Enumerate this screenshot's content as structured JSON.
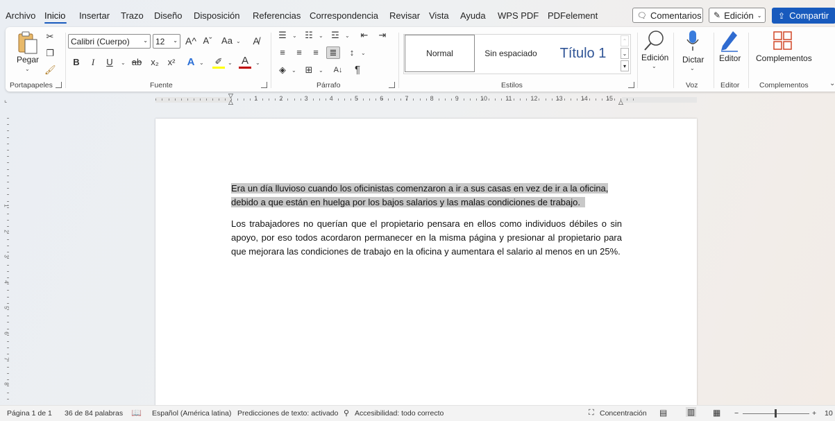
{
  "menu": {
    "items": [
      "Archivo",
      "Inicio",
      "Insertar",
      "Trazo",
      "Diseño",
      "Disposición",
      "Referencias",
      "Correspondencia",
      "Revisar",
      "Vista",
      "Ayuda",
      "WPS PDF",
      "PDFelement"
    ],
    "active": "Inicio"
  },
  "header": {
    "comments_label": "Comentarios",
    "editing_label": "Edición",
    "share_label": "Compartir"
  },
  "ribbon": {
    "clipboard": {
      "paste_label": "Pegar",
      "group_label": "Portapapeles"
    },
    "font": {
      "font_name": "Calibri (Cuerpo)",
      "font_size": "12",
      "grow": "A^",
      "shrink": "Aˇ",
      "case": "Aa",
      "bold": "B",
      "italic": "I",
      "underline": "U",
      "strike": "ab",
      "sub": "x₂",
      "sup": "x²",
      "group_label": "Fuente"
    },
    "paragraph": {
      "group_label": "Párrafo",
      "pilcrow": "¶"
    },
    "styles": {
      "items": [
        "Normal",
        "Sin espaciado",
        "Título 1"
      ],
      "group_label": "Estilos"
    },
    "editing": {
      "label": "Edición"
    },
    "voice": {
      "dictate_label": "Dictar",
      "group_label": "Voz"
    },
    "editor": {
      "label": "Editor",
      "group_label": "Editor"
    },
    "addins": {
      "label": "Complementos",
      "group_label": "Complementos"
    }
  },
  "ruler": {
    "numbers": [
      "1",
      "2",
      "3",
      "4",
      "5",
      "6",
      "7",
      "8",
      "9",
      "10",
      "11",
      "12",
      "13",
      "14",
      "15"
    ]
  },
  "vruler": {
    "numbers": [
      "1",
      "2",
      "3",
      "4",
      "5",
      "6",
      "7",
      "8"
    ]
  },
  "document": {
    "paragraph1": "Era un día lluvioso cuando los oficinistas comenzaron a ir a sus casas en vez de ir a la oficina, debido a que están en huelga por los bajos salarios y las malas condiciones de trabajo.",
    "paragraph1_line1": "Era un día lluvioso cuando los oficinistas comenzaron a ir a sus casas en vez de ir a la oficina,",
    "paragraph1_line2": "debido a que están en huelga por los bajos salarios y las malas condiciones de trabajo.",
    "paragraph2": "Los trabajadores no querían que el propietario pensara en ellos como individuos débiles o sin apoyo, por eso todos acordaron permanecer en la misma página y presionar al propietario para que mejorara las condiciones de trabajo en la oficina y aumentara el salario al menos en un 25%."
  },
  "status": {
    "page": "Página 1 de 1",
    "words": "36 de 84 palabras",
    "language": "Español (América latina)",
    "predictions": "Predicciones de texto: activado",
    "accessibility": "Accesibilidad: todo correcto",
    "focus": "Concentración",
    "zoom": "10"
  },
  "colors": {
    "accent": "#185abd",
    "highlight": "#c8c8c8",
    "font_color_bar": "#c00000",
    "highlight_bar": "#ffff00"
  }
}
